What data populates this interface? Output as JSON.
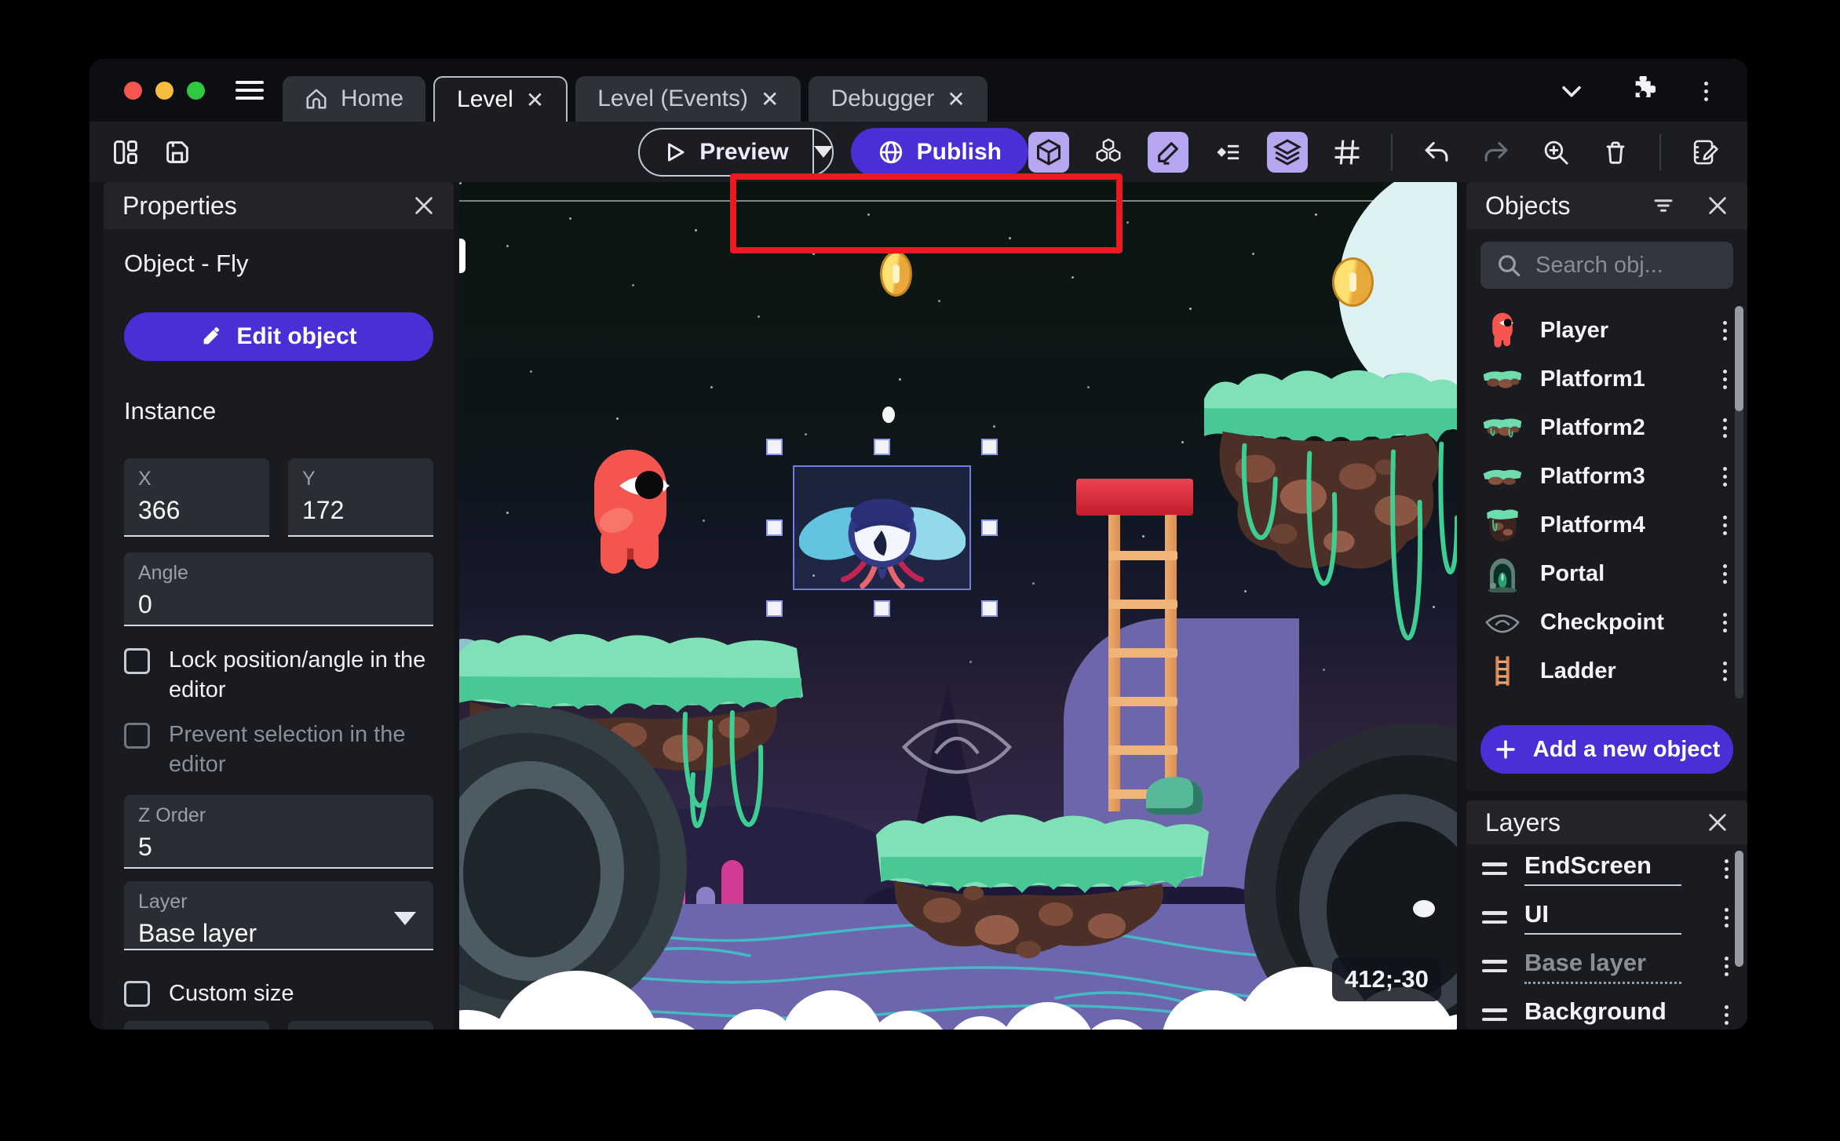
{
  "titlebar": {
    "tabs": [
      {
        "label": "Home"
      },
      {
        "label": "Level"
      },
      {
        "label": "Level (Events)"
      },
      {
        "label": "Debugger"
      }
    ],
    "close_glyph": "✕"
  },
  "toolbar": {
    "preview": "Preview",
    "publish": "Publish"
  },
  "properties_panel": {
    "title": "Properties",
    "object_heading": "Object  - Fly",
    "edit_object": "Edit object",
    "instance_heading": "Instance",
    "x_label": "X",
    "x_value": "366",
    "y_label": "Y",
    "y_value": "172",
    "angle_label": "Angle",
    "angle_value": "0",
    "lock_checkbox": "Lock position/angle in the editor",
    "prevent_checkbox": "Prevent selection in the editor",
    "zorder_label": "Z Order",
    "zorder_value": "5",
    "layer_label": "Layer",
    "layer_value": "Base layer",
    "custom_size_checkbox": "Custom size"
  },
  "objects_panel": {
    "title": "Objects",
    "search_placeholder": "Search obj...",
    "items": [
      {
        "label": "Player"
      },
      {
        "label": "Platform1"
      },
      {
        "label": "Platform2"
      },
      {
        "label": "Platform3"
      },
      {
        "label": "Platform4"
      },
      {
        "label": "Portal"
      },
      {
        "label": "Checkpoint"
      },
      {
        "label": "Ladder"
      }
    ],
    "add_button": "Add a new object"
  },
  "layers_panel": {
    "title": "Layers",
    "items": [
      {
        "label": "EndScreen"
      },
      {
        "label": "UI"
      },
      {
        "label": "Base layer"
      },
      {
        "label": "Background"
      }
    ]
  },
  "canvas": {
    "cursor_coordinates": "412;-30"
  },
  "colors": {
    "accent_purple": "#4c2ed6",
    "annotation_red": "#ea1a20",
    "active_tool_bg": "#b6a6f0",
    "selection_blue": "#6f7ce0",
    "grass_green": "#80e1b7",
    "water_purple": "#6b66ad"
  }
}
